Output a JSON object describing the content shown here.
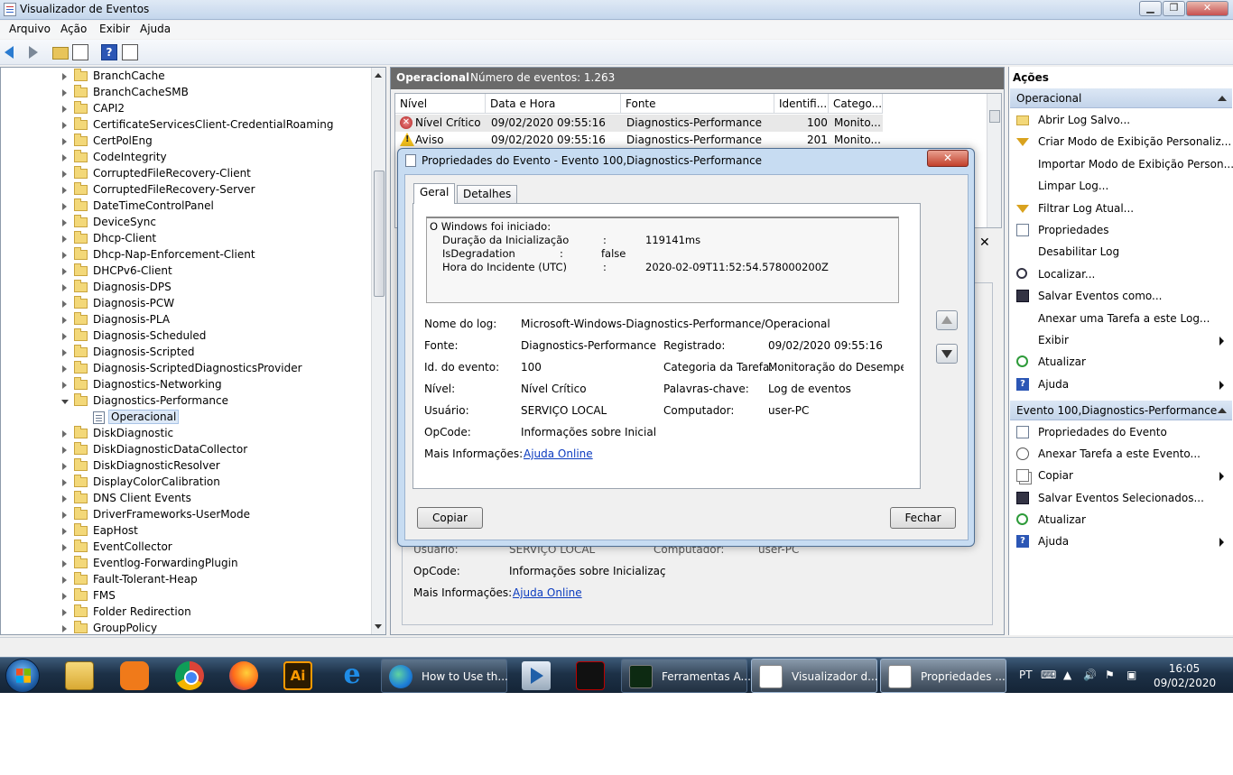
{
  "window": {
    "title": "Visualizador de Eventos"
  },
  "menu": [
    "Arquivo",
    "Ação",
    "Exibir",
    "Ajuda"
  ],
  "tree": {
    "items": [
      {
        "label": "BranchCache",
        "expanded": false
      },
      {
        "label": "BranchCacheSMB",
        "expanded": false
      },
      {
        "label": "CAPI2",
        "expanded": false
      },
      {
        "label": "CertificateServicesClient-CredentialRoaming",
        "expanded": false
      },
      {
        "label": "CertPolEng",
        "expanded": false
      },
      {
        "label": "CodeIntegrity",
        "expanded": false
      },
      {
        "label": "CorruptedFileRecovery-Client",
        "expanded": false
      },
      {
        "label": "CorruptedFileRecovery-Server",
        "expanded": false
      },
      {
        "label": "DateTimeControlPanel",
        "expanded": false
      },
      {
        "label": "DeviceSync",
        "expanded": false
      },
      {
        "label": "Dhcp-Client",
        "expanded": false
      },
      {
        "label": "Dhcp-Nap-Enforcement-Client",
        "expanded": false
      },
      {
        "label": "DHCPv6-Client",
        "expanded": false
      },
      {
        "label": "Diagnosis-DPS",
        "expanded": false
      },
      {
        "label": "Diagnosis-PCW",
        "expanded": false
      },
      {
        "label": "Diagnosis-PLA",
        "expanded": false
      },
      {
        "label": "Diagnosis-Scheduled",
        "expanded": false
      },
      {
        "label": "Diagnosis-Scripted",
        "expanded": false
      },
      {
        "label": "Diagnosis-ScriptedDiagnosticsProvider",
        "expanded": false
      },
      {
        "label": "Diagnostics-Networking",
        "expanded": false
      },
      {
        "label": "Diagnostics-Performance",
        "expanded": true
      },
      {
        "label": "Operacional",
        "child": true
      },
      {
        "label": "DiskDiagnostic",
        "expanded": false
      },
      {
        "label": "DiskDiagnosticDataCollector",
        "expanded": false
      },
      {
        "label": "DiskDiagnosticResolver",
        "expanded": false
      },
      {
        "label": "DisplayColorCalibration",
        "expanded": false
      },
      {
        "label": "DNS Client Events",
        "expanded": false
      },
      {
        "label": "DriverFrameworks-UserMode",
        "expanded": false
      },
      {
        "label": "EapHost",
        "expanded": false
      },
      {
        "label": "EventCollector",
        "expanded": false
      },
      {
        "label": "Eventlog-ForwardingPlugin",
        "expanded": false
      },
      {
        "label": "Fault-Tolerant-Heap",
        "expanded": false
      },
      {
        "label": "FMS",
        "expanded": false
      },
      {
        "label": "Folder Redirection",
        "expanded": false
      },
      {
        "label": "GroupPolicy",
        "expanded": false
      }
    ]
  },
  "center": {
    "log_name": "Operacional",
    "event_count": "Número de eventos: 1.263",
    "columns": [
      "Nível",
      "Data e Hora",
      "Fonte",
      "Identifi...",
      "Catego..."
    ],
    "rows": [
      {
        "level": "Nível Crítico",
        "icon": "error-icon",
        "date": "09/02/2020 09:55:16",
        "source": "Diagnostics-Performance",
        "id": "100",
        "category": "Monito..."
      },
      {
        "level": "Aviso",
        "icon": "warning-icon",
        "date": "09/02/2020 09:55:16",
        "source": "Diagnostics-Performance",
        "id": "201",
        "category": "Monito..."
      }
    ],
    "detail_close": "✕",
    "detail": {
      "usuario_label": "Usuário:",
      "usuario": "SERVIÇO LOCAL",
      "computador_label": "Computador:",
      "computador": "user-PC",
      "opcode_label": "OpCode:",
      "opcode": "Informações sobre Inicializaç",
      "mais_label": "Mais Informações:",
      "mais_link": "Ajuda Online"
    }
  },
  "actions": {
    "title": "Ações",
    "group1": {
      "label": "Operacional",
      "items": [
        {
          "label": "Abrir Log Salvo...",
          "icon": "folder-open-icon",
          "submenu": false
        },
        {
          "label": "Criar Modo de Exibição Personaliz...",
          "icon": "filter-icon",
          "submenu": false
        },
        {
          "label": "Importar Modo de Exibição Person...",
          "icon": "",
          "submenu": false
        },
        {
          "label": "Limpar Log...",
          "icon": "",
          "submenu": false
        },
        {
          "label": "Filtrar Log Atual...",
          "icon": "filter-icon",
          "submenu": false
        },
        {
          "label": "Propriedades",
          "icon": "properties-icon",
          "submenu": false
        },
        {
          "label": "Desabilitar Log",
          "icon": "",
          "submenu": false
        },
        {
          "label": "Localizar...",
          "icon": "binoculars-icon",
          "submenu": false
        },
        {
          "label": "Salvar Eventos como...",
          "icon": "save-icon",
          "submenu": false
        },
        {
          "label": "Anexar uma Tarefa a este Log...",
          "icon": "",
          "submenu": false
        },
        {
          "label": "Exibir",
          "icon": "",
          "submenu": true
        },
        {
          "label": "Atualizar",
          "icon": "refresh-icon",
          "submenu": false
        },
        {
          "label": "Ajuda",
          "icon": "help-icon",
          "submenu": true
        }
      ]
    },
    "group2": {
      "label": "Evento 100,Diagnostics-Performance",
      "items": [
        {
          "label": "Propriedades do Evento",
          "icon": "properties-icon",
          "submenu": false
        },
        {
          "label": "Anexar Tarefa a este Evento...",
          "icon": "task-icon",
          "submenu": false
        },
        {
          "label": "Copiar",
          "icon": "copy-icon",
          "submenu": true
        },
        {
          "label": "Salvar Eventos Selecionados...",
          "icon": "save-icon",
          "submenu": false
        },
        {
          "label": "Atualizar",
          "icon": "refresh-icon",
          "submenu": false
        },
        {
          "label": "Ajuda",
          "icon": "help-icon",
          "submenu": true
        }
      ]
    }
  },
  "dialog": {
    "title": "Propriedades do Evento - Evento 100,Diagnostics-Performance",
    "close": "✕",
    "tabs": [
      "Geral",
      "Detalhes"
    ],
    "event_text": {
      "line1": "O Windows foi iniciado:",
      "rows": [
        {
          "key": "Duração da Inicialização",
          "sep": ":",
          "value": "119141ms"
        },
        {
          "key": "IsDegradation",
          "sep": ":",
          "value": "false"
        },
        {
          "key": "Hora do Incidente (UTC)",
          "sep": ":",
          "value": "2020-02-09T11:52:54.578000200Z"
        }
      ]
    },
    "fields": {
      "nome_log_label": "Nome do log:",
      "nome_log": "Microsoft-Windows-Diagnostics-Performance/Operacional",
      "fonte_label": "Fonte:",
      "fonte": "Diagnostics-Performance",
      "registrado_label": "Registrado:",
      "registrado": "09/02/2020 09:55:16",
      "id_label": "Id. do evento:",
      "id": "100",
      "categoria_label": "Categoria da Tarefa:",
      "categoria": "Monitoração do Desempenh",
      "nivel_label": "Nível:",
      "nivel": "Nível Crítico",
      "palavras_label": "Palavras-chave:",
      "palavras": "Log de eventos",
      "usuario_label": "Usuário:",
      "usuario": "SERVIÇO LOCAL",
      "computador_label": "Computador:",
      "computador": "user-PC",
      "opcode_label": "OpCode:",
      "opcode": "Informações sobre Inicializaç",
      "mais_label": "Mais Informações:",
      "mais_link": "Ajuda Online"
    },
    "buttons": {
      "copy": "Copiar",
      "close": "Fechar"
    }
  },
  "taskbar": {
    "tasks": [
      {
        "label": "How to Use th...",
        "icon": "edge-icon",
        "active": false
      },
      {
        "label": "Ferramentas A...",
        "icon": "perfmon-icon",
        "active": false
      },
      {
        "label": "Visualizador d...",
        "icon": "event-viewer-icon",
        "active": true
      },
      {
        "label": "Propriedades ...",
        "icon": "event-properties-icon",
        "active": true
      }
    ],
    "language": "PT",
    "time": "16:05",
    "date": "09/02/2020"
  },
  "colors": {
    "accent": "#c7dcf2",
    "critical": "#b02020",
    "warning": "#f4c11c",
    "link": "#0b3bbf"
  }
}
